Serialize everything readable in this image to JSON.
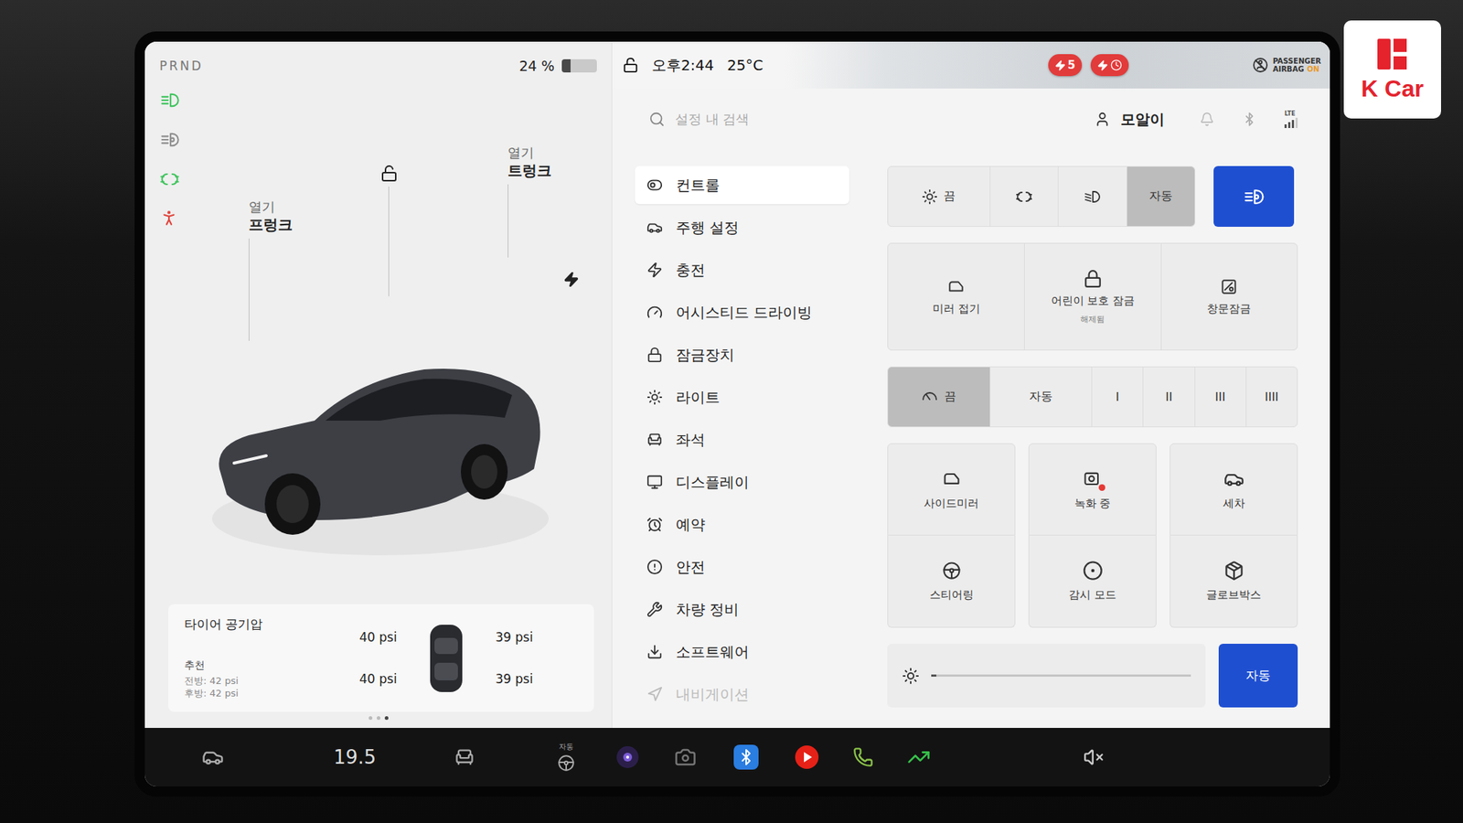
{
  "watermark": {
    "text": "K Car"
  },
  "left_panel": {
    "gear": "PRND",
    "battery": {
      "reading": "24 %",
      "level": 0.24
    },
    "indicators": [
      {
        "kind": "headlights",
        "color": "#3ec45c"
      },
      {
        "kind": "auto-high-beam",
        "color": "#8e8e8e"
      },
      {
        "kind": "parking-lights",
        "color": "#3ec45c"
      },
      {
        "kind": "seatbelt",
        "color": "#e0443c"
      }
    ]
  },
  "car": {
    "locked": false,
    "charging": true,
    "frunk": {
      "action": "열기",
      "label": "프렁크"
    },
    "trunk": {
      "action": "열기",
      "label": "트렁크"
    }
  },
  "tires": {
    "title": "타이어 공기압",
    "recommended_label": "추천",
    "recommended": [
      "전방: 42 psi",
      "후방: 42 psi"
    ],
    "front_left": "40 psi",
    "front_right": "39 psi",
    "rear_left": "40 psi",
    "rear_right": "39 psi"
  },
  "page_dots": [
    {
      "selected": false
    },
    {
      "selected": false
    },
    {
      "selected": true
    }
  ],
  "status_bar": {
    "locked": false,
    "time": "오후2:44",
    "temperature": "25°C",
    "alerts": [
      {
        "kind": "supercharger",
        "text": "5"
      },
      {
        "kind": "scheduled"
      }
    ],
    "airbag": {
      "line1": "PASSENGER",
      "line2": "AIRBAG",
      "state": "ON"
    }
  },
  "header": {
    "search_placeholder": "설정 내 검색",
    "profile": "모알이",
    "signal": {
      "network": "LTE",
      "level": 0.75
    }
  },
  "menu": [
    {
      "label": "컨트롤",
      "kind": "controls",
      "selected": true,
      "dimmed": false
    },
    {
      "label": "주행 설정",
      "kind": "driving",
      "selected": false,
      "dimmed": false
    },
    {
      "label": "충전",
      "kind": "charging",
      "selected": false,
      "dimmed": false
    },
    {
      "label": "어시스티드 드라이빙",
      "kind": "assisted",
      "selected": false,
      "dimmed": false
    },
    {
      "label": "잠금장치",
      "kind": "locks",
      "selected": false,
      "dimmed": false
    },
    {
      "label": "라이트",
      "kind": "lights",
      "selected": false,
      "dimmed": false
    },
    {
      "label": "좌석",
      "kind": "seats",
      "selected": false,
      "dimmed": false
    },
    {
      "label": "디스플레이",
      "kind": "display",
      "selected": false,
      "dimmed": false
    },
    {
      "label": "예약",
      "kind": "schedule",
      "selected": false,
      "dimmed": false
    },
    {
      "label": "안전",
      "kind": "safety",
      "selected": false,
      "dimmed": false
    },
    {
      "label": "차량 정비",
      "kind": "service",
      "selected": false,
      "dimmed": false
    },
    {
      "label": "소프트웨어",
      "kind": "software",
      "selected": false,
      "dimmed": false
    },
    {
      "label": "내비게이션",
      "kind": "navigation",
      "selected": false,
      "dimmed": true
    }
  ],
  "lights": {
    "options": [
      {
        "kind": "off",
        "label": "끔",
        "selected": false
      },
      {
        "kind": "parking",
        "selected": false
      },
      {
        "kind": "low-beam",
        "selected": false
      },
      {
        "kind": "auto",
        "label": "자동",
        "selected": true
      }
    ],
    "auto_high_beam": true
  },
  "toggles": [
    {
      "kind": "mirror-fold",
      "label": "미러 접기"
    },
    {
      "kind": "child-lock",
      "label": "어린이 보호 잠금",
      "sub": "해제됨"
    },
    {
      "kind": "window-lock",
      "label": "창문잠금"
    }
  ],
  "wipers": [
    {
      "kind": "off",
      "label": "끔",
      "selected": true
    },
    {
      "kind": "auto",
      "label": "자동",
      "selected": false
    },
    {
      "kind": "speed",
      "label": "I",
      "selected": false
    },
    {
      "kind": "speed",
      "label": "II",
      "selected": false
    },
    {
      "kind": "speed",
      "label": "III",
      "selected": false
    },
    {
      "kind": "speed",
      "label": "IIII",
      "selected": false
    }
  ],
  "shortcuts": [
    {
      "kind": "side-mirror",
      "label": "사이드미러"
    },
    {
      "kind": "dashcam",
      "label": "녹화 중",
      "recording": true
    },
    {
      "kind": "car-wash",
      "label": "세차"
    },
    {
      "kind": "steering",
      "label": "스티어링"
    },
    {
      "kind": "sentry",
      "label": "감시 모드"
    },
    {
      "kind": "glovebox",
      "label": "글로브박스"
    }
  ],
  "brightness": {
    "level": 0.02,
    "auto": {
      "label": "자동",
      "on": true
    }
  },
  "dock": {
    "temperature": "19.5",
    "steering_heat": "자동",
    "muted": true,
    "items": [
      {
        "kind": "car"
      },
      {
        "kind": "climate"
      },
      {
        "kind": "seat-heater"
      },
      {
        "kind": "steering-heater"
      },
      {
        "kind": "camera"
      },
      {
        "kind": "dashcam"
      },
      {
        "kind": "bluetooth"
      },
      {
        "kind": "youtube"
      },
      {
        "kind": "phone"
      },
      {
        "kind": "stocks"
      },
      {
        "kind": "volume"
      }
    ]
  }
}
